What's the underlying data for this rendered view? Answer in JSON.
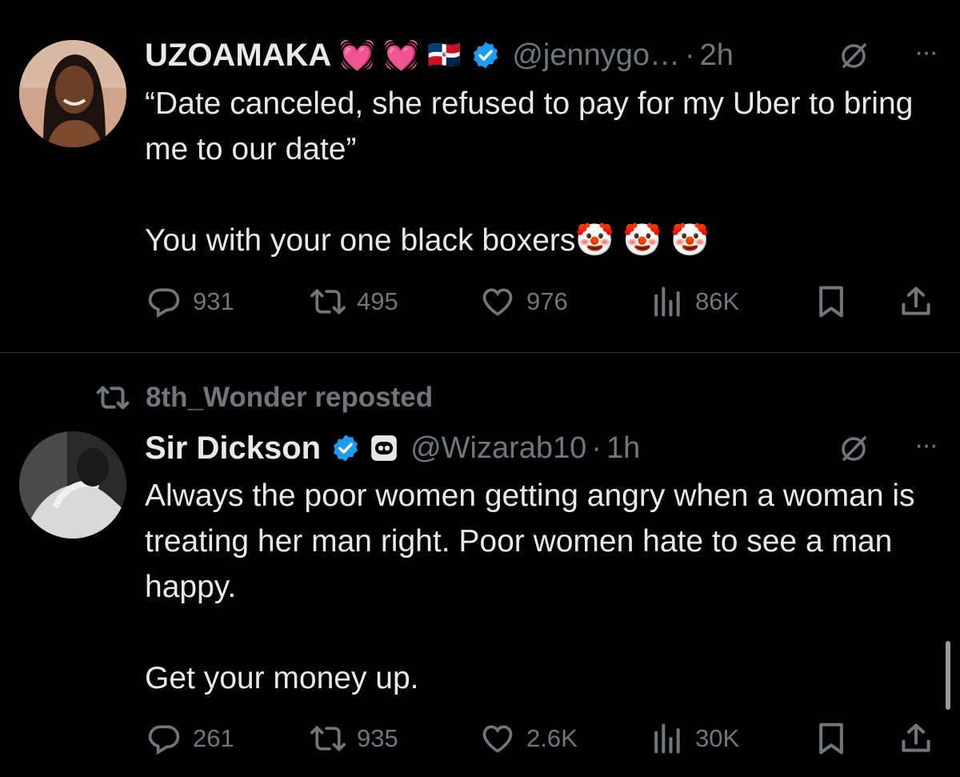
{
  "tweets": [
    {
      "author": {
        "name": "UZOAMAKA",
        "handle": "@jennygo…",
        "emojis": [
          "💓",
          "💓",
          "🇩🇴"
        ]
      },
      "time": "2h",
      "text": "“Date canceled, she refused to pay for my Uber to bring me to our date”\n\nYou with your one black boxers🤡 🤡 🤡",
      "stats": {
        "replies": "931",
        "reposts": "495",
        "likes": "976",
        "views": "86K"
      }
    },
    {
      "social_context": "8th_Wonder reposted",
      "author": {
        "name": "Sir Dickson",
        "handle": "@Wizarab10"
      },
      "time": "1h",
      "text": "Always the poor women getting angry when a woman is treating her man right. Poor women hate to see a man happy.\n\nGet your money up.",
      "stats": {
        "replies": "261",
        "reposts": "935",
        "likes": "2.6K",
        "views": "30K"
      }
    }
  ],
  "ui": {
    "separator": "·",
    "more_glyph": "···"
  },
  "colors": {
    "background": "#000000",
    "text": "#e7e9ea",
    "muted": "#71767b",
    "verified": "#1d9bf0"
  },
  "icons": [
    "reply-icon",
    "retweet-icon",
    "like-icon",
    "views-icon",
    "bookmark-icon",
    "share-icon",
    "grok-icon",
    "verified-icon",
    "more-icon"
  ]
}
